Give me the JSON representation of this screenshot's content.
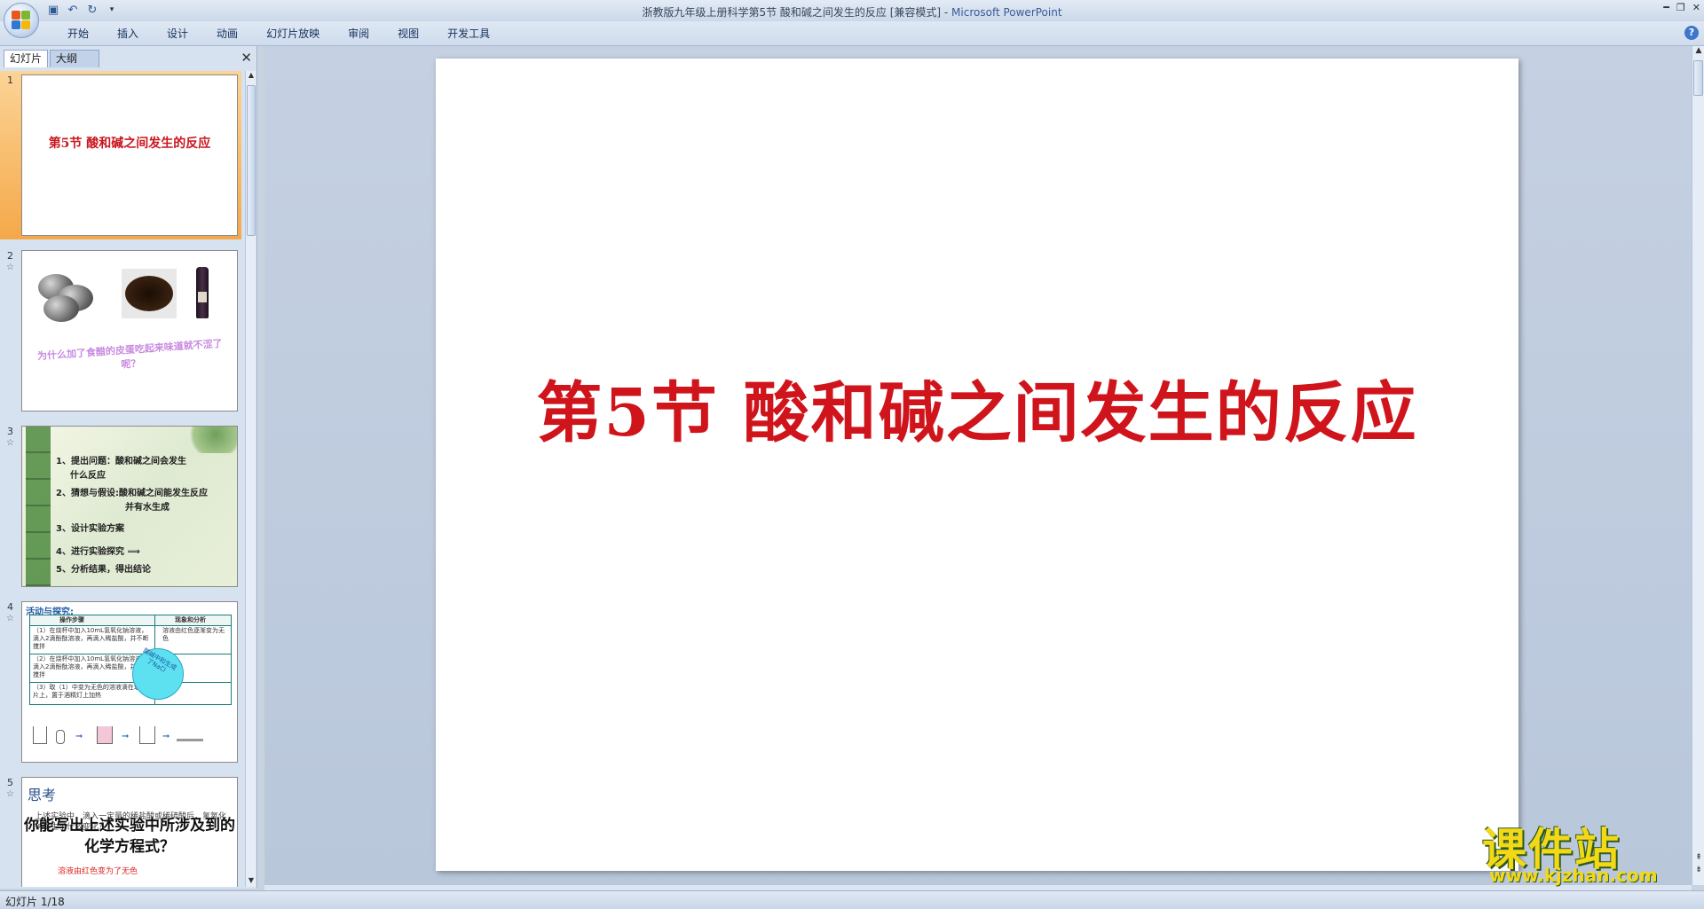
{
  "window": {
    "title": "浙教版九年级上册科学第5节 酸和碱之间发生的反应 [兼容模式]",
    "app_name": "Microsoft PowerPoint",
    "separator": " - "
  },
  "ribbon": {
    "tabs": [
      "开始",
      "插入",
      "设计",
      "动画",
      "幻灯片放映",
      "审阅",
      "视图",
      "开发工具"
    ]
  },
  "left_pane": {
    "tab_slides": "幻灯片",
    "tab_outline": "大纲",
    "close": "✕"
  },
  "thumbnails": [
    {
      "num": "1",
      "title": "第5节  酸和碱之间发生的反应"
    },
    {
      "num": "2",
      "question": "为什么加了食醋的皮蛋吃起来味道就不涩了呢？"
    },
    {
      "num": "3",
      "lines": [
        "1、提出问题：酸和碱之间会发生",
        "什么反应",
        "2、猜想与假设:酸和碱之间能发生反应",
        "并有水生成",
        "3、设计实验方案",
        "4、进行实验探究 ⟹",
        "5、分析结果，得出结论"
      ]
    },
    {
      "num": "4",
      "heading": "活动与探究:",
      "col1": "操作步骤",
      "col2": "现象和分析",
      "rows": [
        "（1）在烧杯中加入10mL氢氧化钠溶液，滴入2滴酚酞溶液，再滴入稀盐酸，并不断搅拌",
        "（2）在烧杯中加入10mL氢氧化钠溶液，滴入2滴酚酞溶液，再滴入稀盐酸，并不断搅拌",
        "（3）取（1）中变为无色的溶液滴在玻璃片上，置于酒精灯上加热"
      ],
      "row1_result": "溶液由红色逐渐变为无色",
      "bubble": "酸碱中和生成了NaCl"
    },
    {
      "num": "5",
      "title": "思考",
      "small": "上述实验中，滴入一定量的稀盐酸或稀硫酸后，氢氧化钠发生了什么变化？",
      "big": "你能写出上述实验中所涉及到的化学方程式？",
      "red": "溶液由红色变为了无色"
    }
  ],
  "slide": {
    "title": "第5节  酸和碱之间发生的反应"
  },
  "watermark": {
    "cn": "课件站",
    "url": "www.kjzhan.com"
  },
  "status": {
    "slide_info": "幻灯片 1/18"
  },
  "colors": {
    "title_red": "#d0141c",
    "selected_thumb": "#f5a84a",
    "workspace": "#c5d1e2"
  }
}
